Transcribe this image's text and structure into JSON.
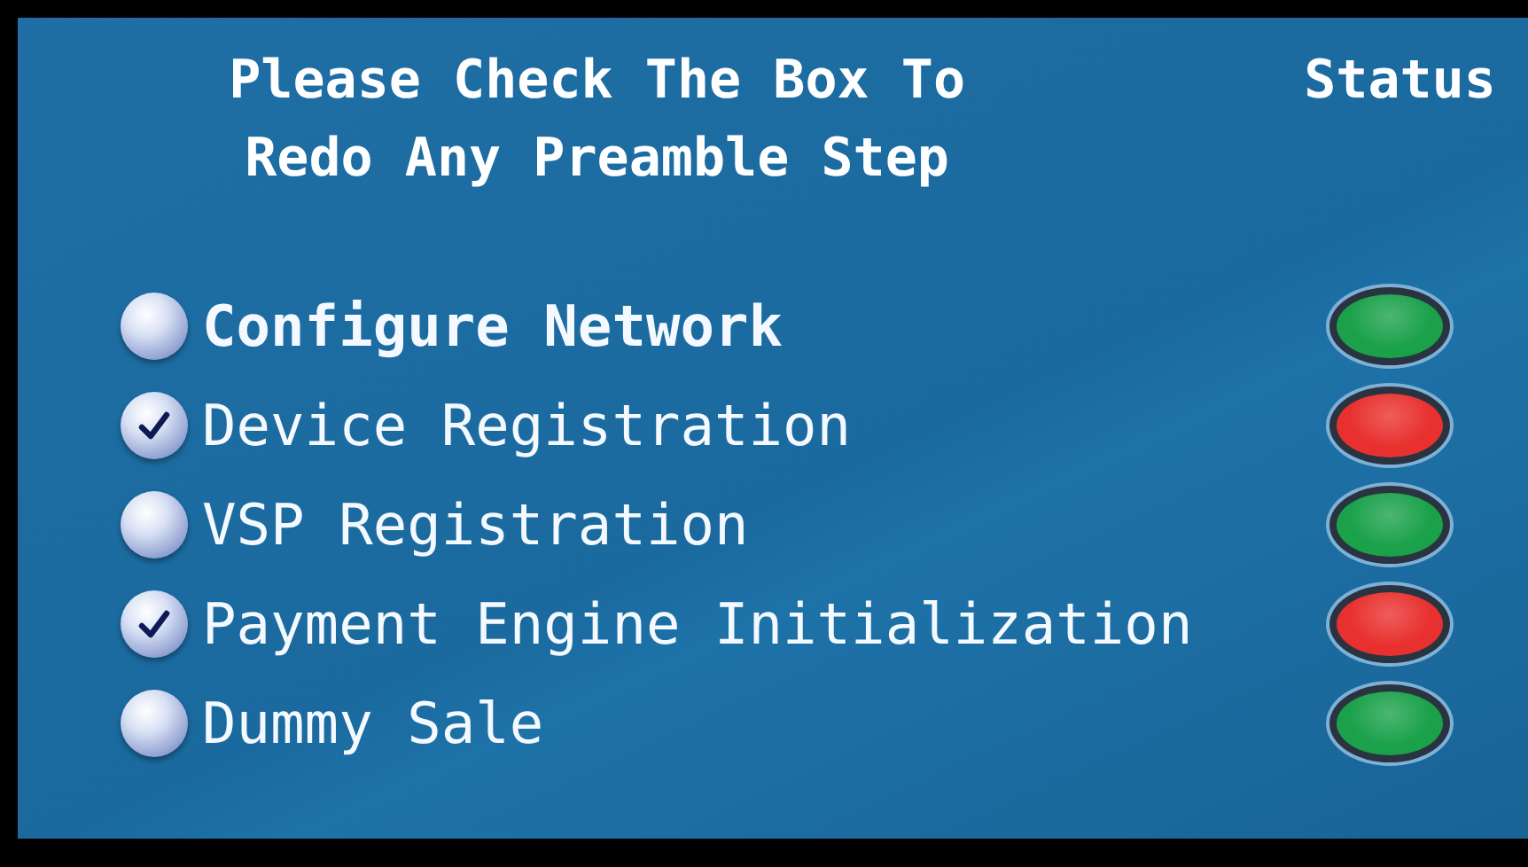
{
  "heading": {
    "lines": [
      "Please Check The Box To",
      "Redo Any Preamble Step"
    ]
  },
  "status_heading": "Status",
  "steps": [
    {
      "label": "Configure Network",
      "checked": false,
      "highlighted": true,
      "color": "#1aa14a"
    },
    {
      "label": "Device Registration",
      "checked": true,
      "highlighted": false,
      "color": "#e8302e"
    },
    {
      "label": "VSP Registration",
      "checked": false,
      "highlighted": false,
      "color": "#1aa14a"
    },
    {
      "label": "Payment Engine Initialization",
      "checked": true,
      "highlighted": false,
      "color": "#e8302e"
    },
    {
      "label": "Dummy Sale",
      "checked": false,
      "highlighted": false,
      "color": "#1aa14a"
    }
  ]
}
